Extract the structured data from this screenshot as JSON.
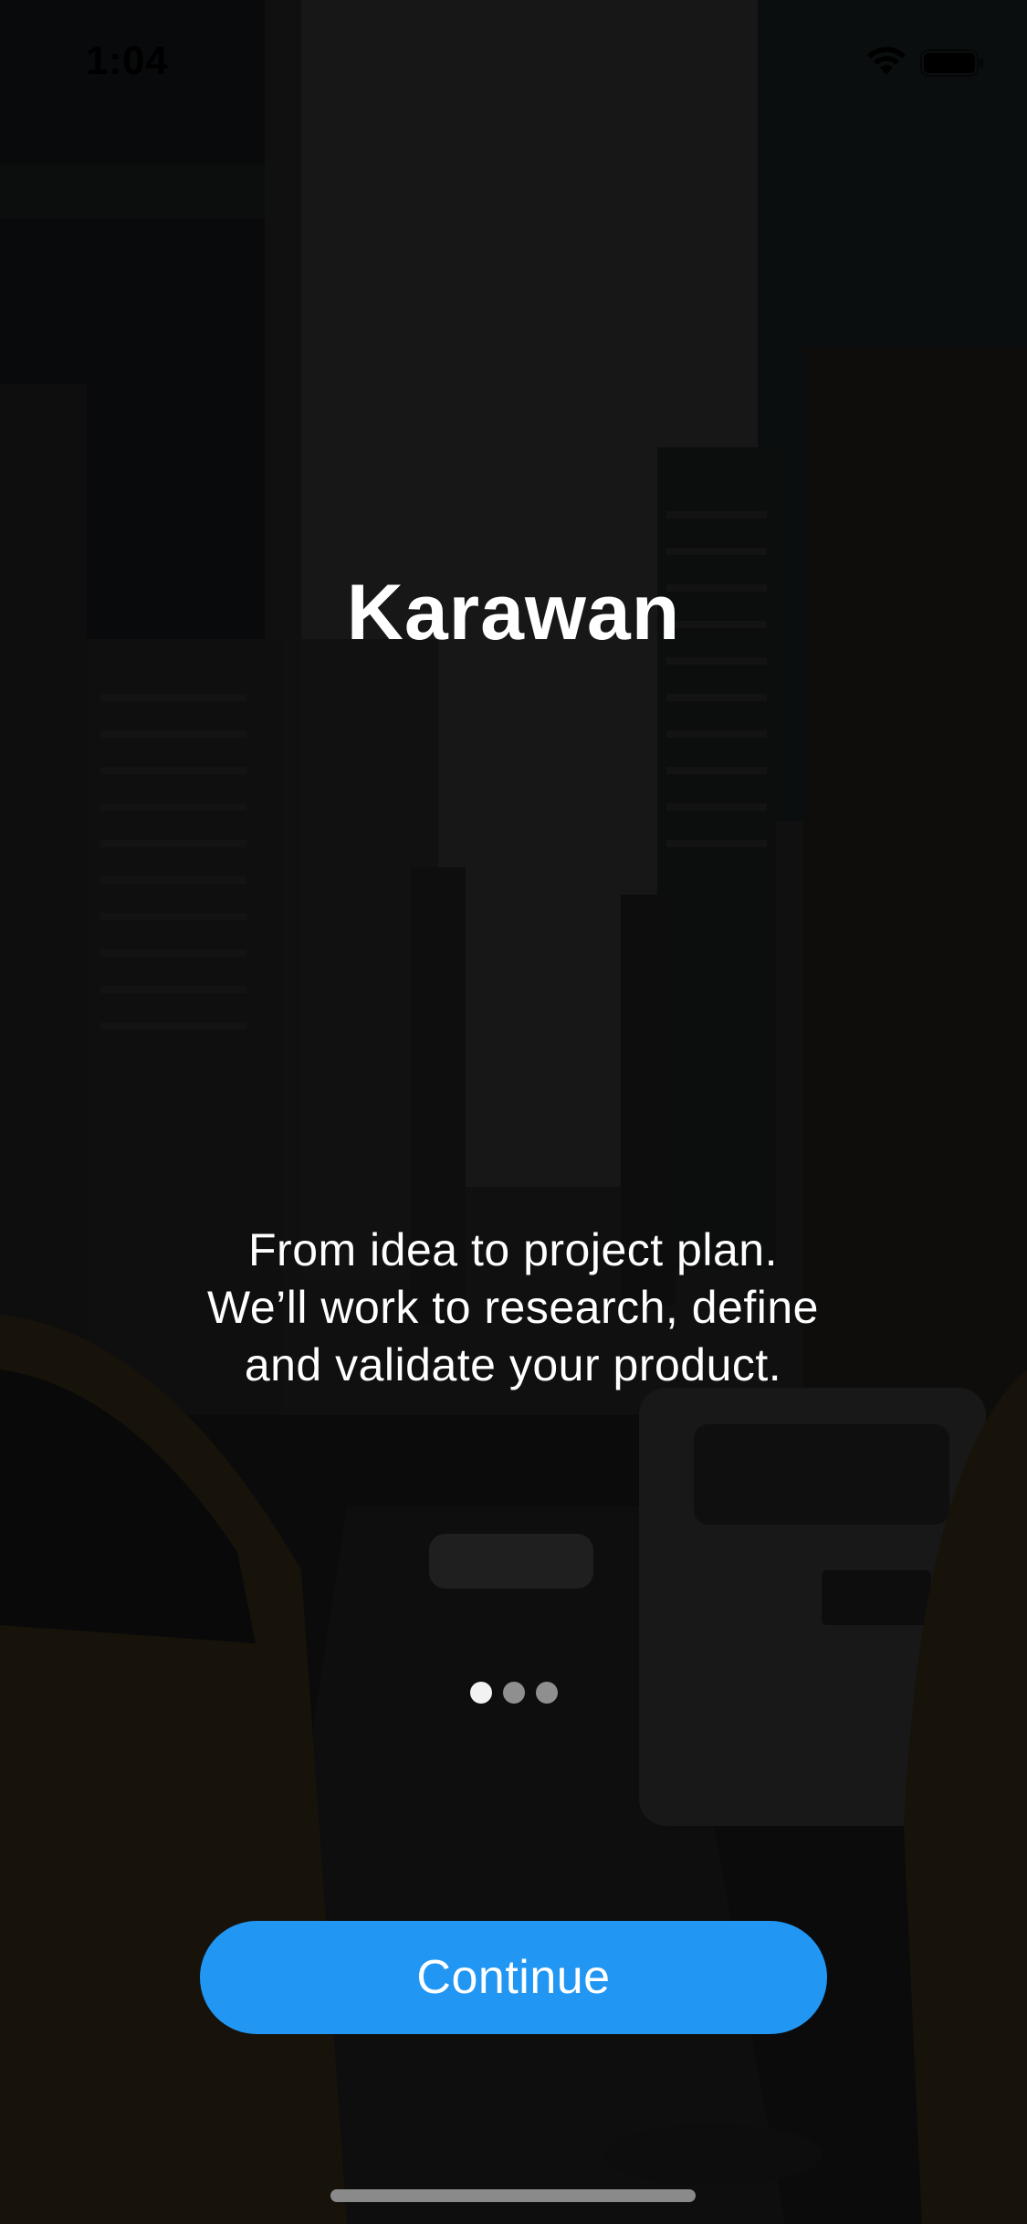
{
  "status_bar": {
    "time": "1:04",
    "wifi_icon": "wifi-icon",
    "battery_icon": "battery-icon"
  },
  "onboarding": {
    "title": "Karawan",
    "tagline": "From idea to project plan. We’ll work to research, define and validate your product.",
    "page_indicator": {
      "total_pages": 3,
      "current_page": 1
    },
    "continue_label": "Continue"
  },
  "colors": {
    "accent": "#2196f3",
    "text": "#ffffff",
    "dot_active": "#f2f2f2",
    "dot_inactive": "#8f8f8f"
  }
}
